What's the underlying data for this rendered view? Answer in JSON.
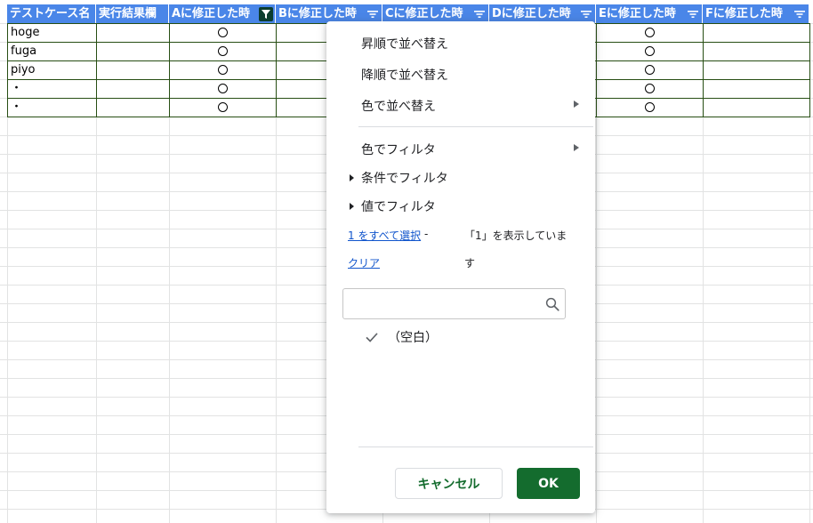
{
  "sheet": {
    "headers": [
      {
        "label": "テストケース名",
        "filter": "none"
      },
      {
        "label": "実行結果欄",
        "filter": "none"
      },
      {
        "label": "Aに修正した時",
        "filter": "active"
      },
      {
        "label": "Bに修正した時",
        "filter": "available"
      },
      {
        "label": "Cに修正した時",
        "filter": "available"
      },
      {
        "label": "Dに修正した時",
        "filter": "available"
      },
      {
        "label": "Eに修正した時",
        "filter": "available"
      },
      {
        "label": "Fに修正した時",
        "filter": "available"
      }
    ],
    "rows": [
      {
        "name": "hoge",
        "a_mark": "circle",
        "e_mark": "circle"
      },
      {
        "name": "fuga",
        "a_mark": "circle",
        "e_mark": "circle"
      },
      {
        "name": "piyo",
        "a_mark": "circle",
        "e_mark": "circle"
      },
      {
        "name": "・",
        "a_mark": "circle",
        "e_mark": "circle"
      },
      {
        "name": "・",
        "a_mark": "circle",
        "e_mark": "circle"
      }
    ],
    "colors": {
      "header_bg": "#4a86e8",
      "header_text": "#ffffff",
      "active_filter_bg": "#0b3d2e",
      "data_border": "#274e13"
    }
  },
  "filter_menu": {
    "sort_asc": "昇順で並べ替え",
    "sort_desc": "降順で並べ替え",
    "sort_by_color": "色で並べ替え",
    "filter_by_color": "色でフィルタ",
    "filter_by_condition": "条件でフィルタ",
    "filter_by_values": "値でフィルタ",
    "select_all": "1 をすべて選択",
    "select_all_sep": "-",
    "showing_text_1": "「1」を表示していま",
    "showing_text_2": "す",
    "clear": "クリア",
    "search_value": "",
    "search_icon": "search-icon",
    "values": [
      {
        "label": "（空白）",
        "checked": true
      }
    ],
    "cancel_label": "キャンセル",
    "ok_label": "OK",
    "colors": {
      "ok_bg": "#146c2e",
      "cancel_text": "#146c2e",
      "link": "#1155cc"
    }
  }
}
